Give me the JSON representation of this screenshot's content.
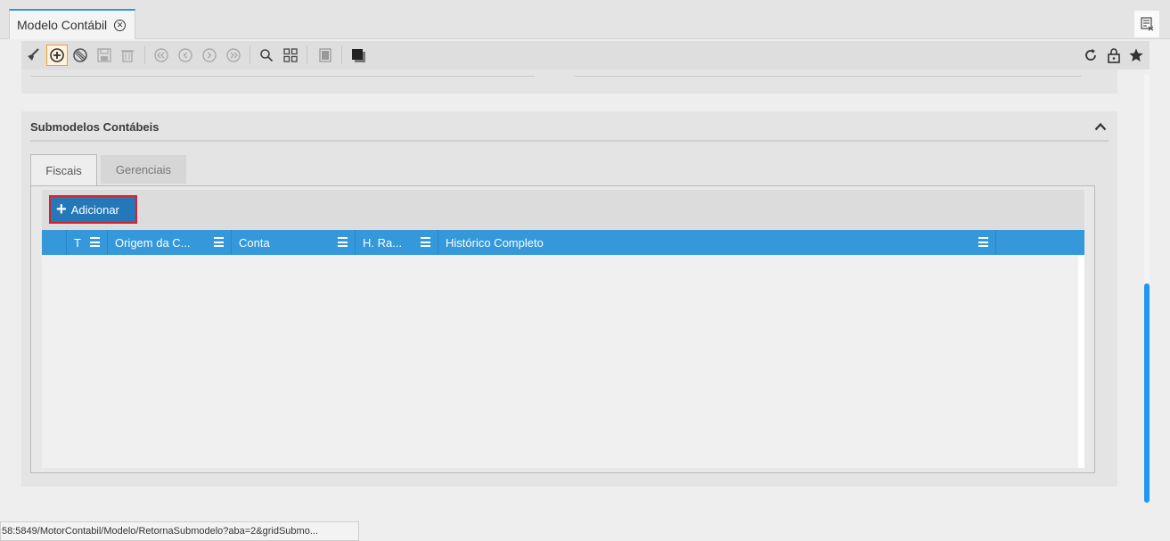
{
  "window": {
    "tab_title": "Modelo Contábil",
    "tab_close_icon": "close-circle-icon",
    "menu_icon": "window-list-icon"
  },
  "toolbar": {
    "left_icons": [
      "broom-icon",
      "add-circle-icon",
      "cancel-circle-icon",
      "save-icon",
      "trash-icon",
      "first-record-icon",
      "previous-record-icon",
      "next-record-icon",
      "last-record-icon",
      "search-icon",
      "grid-view-icon",
      "document-icon",
      "stack-icon"
    ],
    "right_icons": [
      "refresh-icon",
      "lock-icon",
      "star-icon"
    ]
  },
  "section": {
    "title": "Submodelos Contábeis",
    "toggle_icon": "chevron-up-icon",
    "tabs": [
      {
        "label": "Fiscais",
        "active": true
      },
      {
        "label": "Gerenciais",
        "active": false
      }
    ],
    "add_button_label": "Adicionar",
    "grid": {
      "columns": [
        {
          "label": ""
        },
        {
          "label": "T"
        },
        {
          "label": "Origem da C..."
        },
        {
          "label": "Conta"
        },
        {
          "label": "H. Ra..."
        },
        {
          "label": "Histórico Completo"
        }
      ],
      "rows": []
    }
  },
  "status_bar": {
    "url": "58:5849/MotorContabil/Modelo/RetornaSubmodelo?aba=2&gridSubmo..."
  },
  "colors": {
    "accent": "#3498db",
    "button": "#2478b8",
    "highlight_border": "#d1242f",
    "scroll_thumb": "#2196f3"
  }
}
